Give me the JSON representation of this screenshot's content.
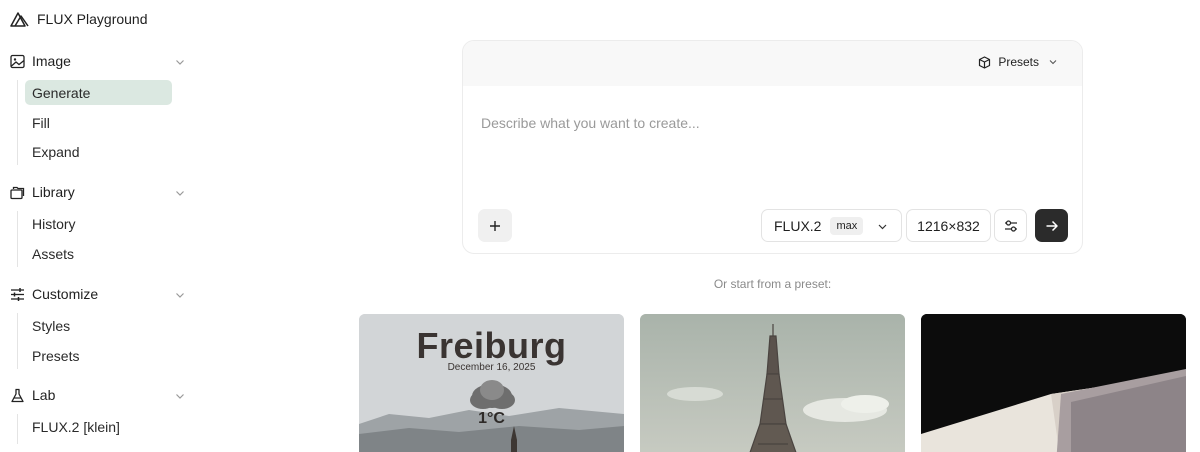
{
  "app": {
    "title": "FLUX Playground"
  },
  "sidebar": {
    "sections": [
      {
        "title": "Image",
        "icon": "image-icon",
        "items": [
          "Generate",
          "Fill",
          "Expand"
        ],
        "active": "Generate"
      },
      {
        "title": "Library",
        "icon": "folders-icon",
        "items": [
          "History",
          "Assets"
        ]
      },
      {
        "title": "Customize",
        "icon": "sliders-icon",
        "items": [
          "Styles",
          "Presets"
        ]
      },
      {
        "title": "Lab",
        "icon": "flask-icon",
        "items": [
          "FLUX.2 [klein]"
        ]
      }
    ]
  },
  "prompt": {
    "placeholder": "Describe what you want to create...",
    "presets_label": "Presets",
    "model": "FLUX.2",
    "model_variant": "max",
    "size": "1216×832"
  },
  "preset_hint": "Or start from a preset:",
  "presets": [
    {
      "city": "Freiburg",
      "date": "December 16, 2025",
      "temp": "1°C"
    },
    {},
    {}
  ],
  "colors": {
    "active_bg": "#dbe8e1",
    "submit_bg": "#2b2b2b",
    "card_header_bg": "#f8f8f8"
  }
}
